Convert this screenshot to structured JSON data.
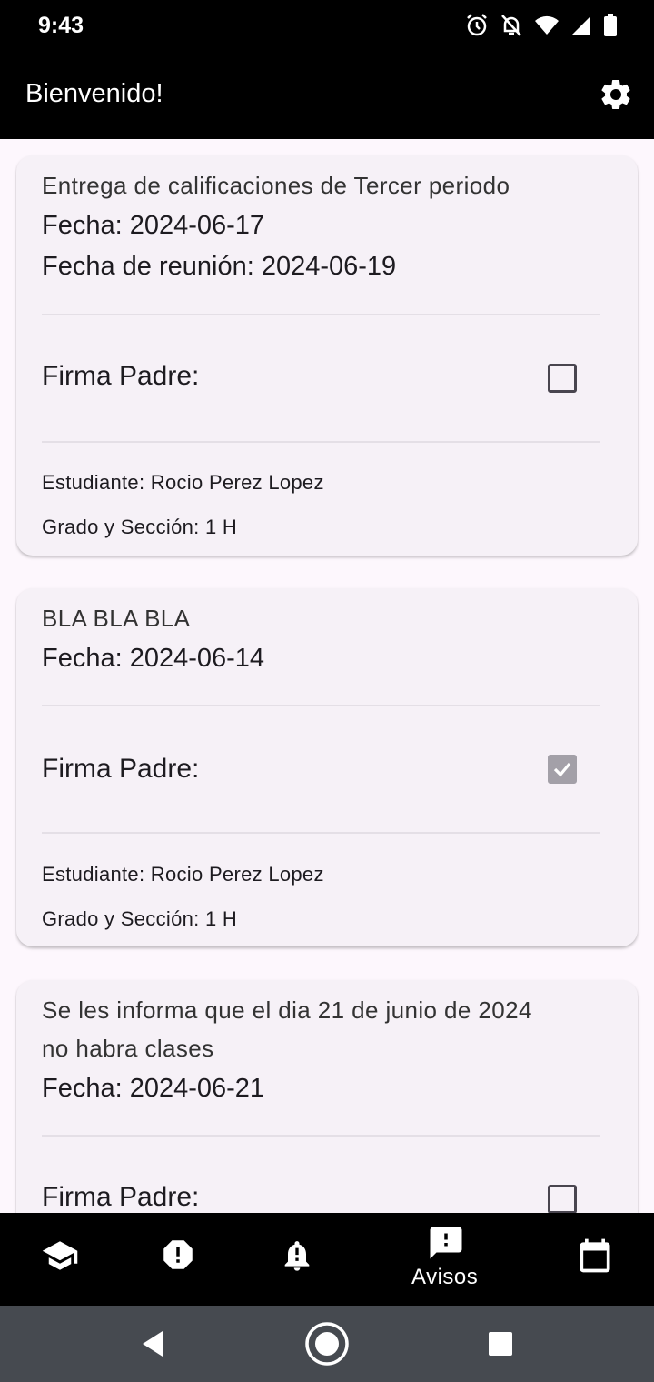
{
  "status_bar": {
    "time": "9:43",
    "icons": [
      "alarm-icon",
      "notifications-off-icon",
      "wifi-icon",
      "signal-icon",
      "battery-icon"
    ]
  },
  "app_bar": {
    "title": "Bienvenido!",
    "settings_icon": "gear-icon"
  },
  "notices": [
    {
      "title": "Entrega de calificaciones de Tercer periodo",
      "fecha": "Fecha: 2024-06-17",
      "fecha_reunion": "Fecha de reunión: 2024-06-19",
      "firma_label": "Firma Padre:",
      "signed": false,
      "estudiante": "Estudiante: Rocio Perez Lopez",
      "grado": "Grado y Sección: 1 H"
    },
    {
      "title": "BLA BLA BLA",
      "fecha": "Fecha: 2024-06-14",
      "firma_label": "Firma Padre:",
      "signed": true,
      "estudiante": "Estudiante: Rocio Perez Lopez",
      "grado": "Grado y Sección: 1 H"
    },
    {
      "title_line1": "Se les informa que el dia 21 de junio de 2024",
      "title_line2": "no habra clases",
      "fecha": "Fecha: 2024-06-21",
      "firma_label": "Firma Padre:",
      "signed": false
    }
  ],
  "bottom_nav": {
    "items": [
      {
        "icon": "school-icon"
      },
      {
        "icon": "alert-octagon-icon"
      },
      {
        "icon": "notification-bell-icon"
      },
      {
        "icon": "feedback-icon",
        "label": "Avisos",
        "selected": true
      },
      {
        "icon": "calendar-icon"
      }
    ]
  },
  "colors": {
    "bar_background": "#000000",
    "page_background": "#fdf7fd",
    "card_background": "#f6f1f7",
    "system_nav": "#464a50"
  }
}
